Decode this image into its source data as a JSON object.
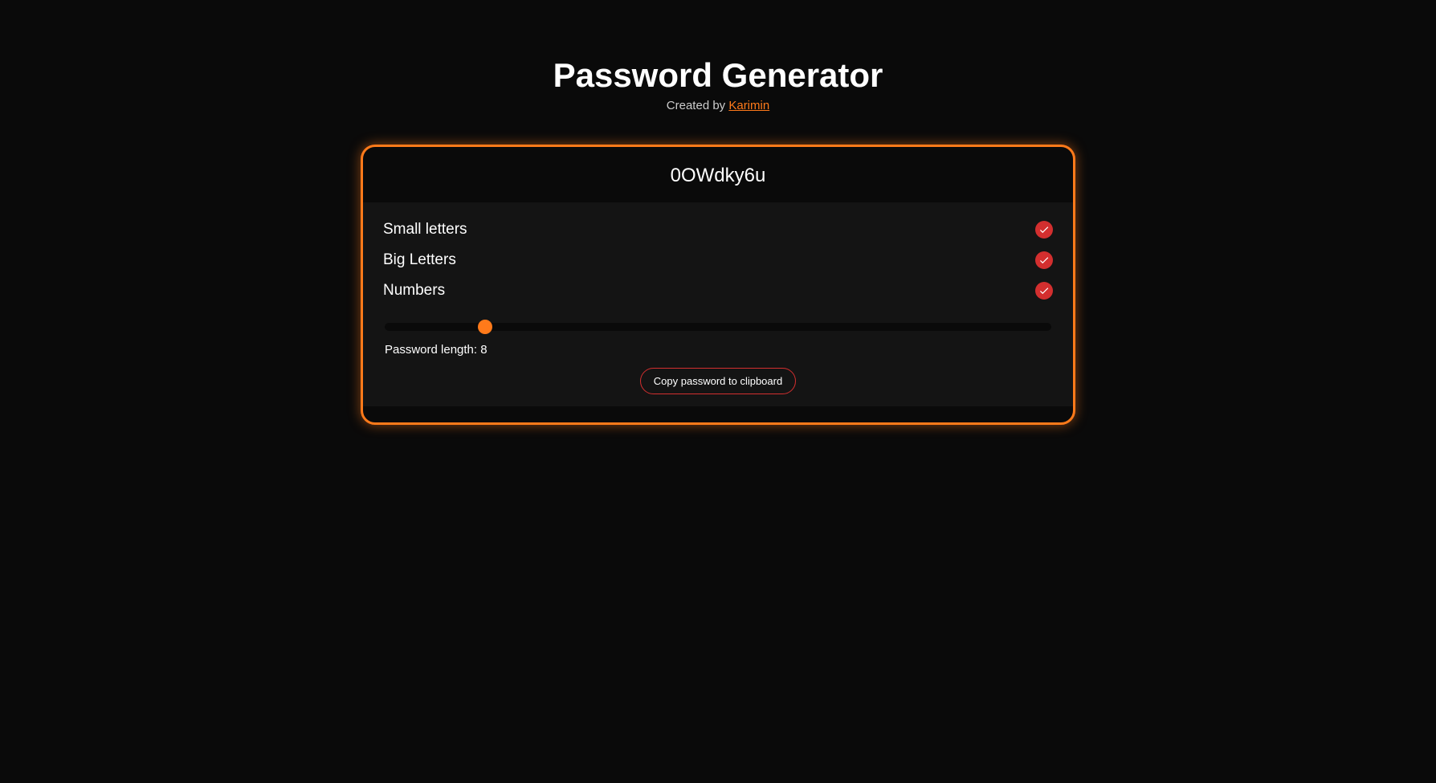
{
  "header": {
    "title": "Password Generator",
    "created_by_prefix": "Created by ",
    "author_name": "Karimin"
  },
  "password": {
    "value": "0OWdky6u"
  },
  "options": [
    {
      "label": "Small letters",
      "checked": true
    },
    {
      "label": "Big Letters",
      "checked": true
    },
    {
      "label": "Numbers",
      "checked": true
    }
  ],
  "slider": {
    "min": 1,
    "max": 50,
    "value": 8,
    "length_label": "Password length: 8"
  },
  "buttons": {
    "copy_label": "Copy password to clipboard"
  }
}
